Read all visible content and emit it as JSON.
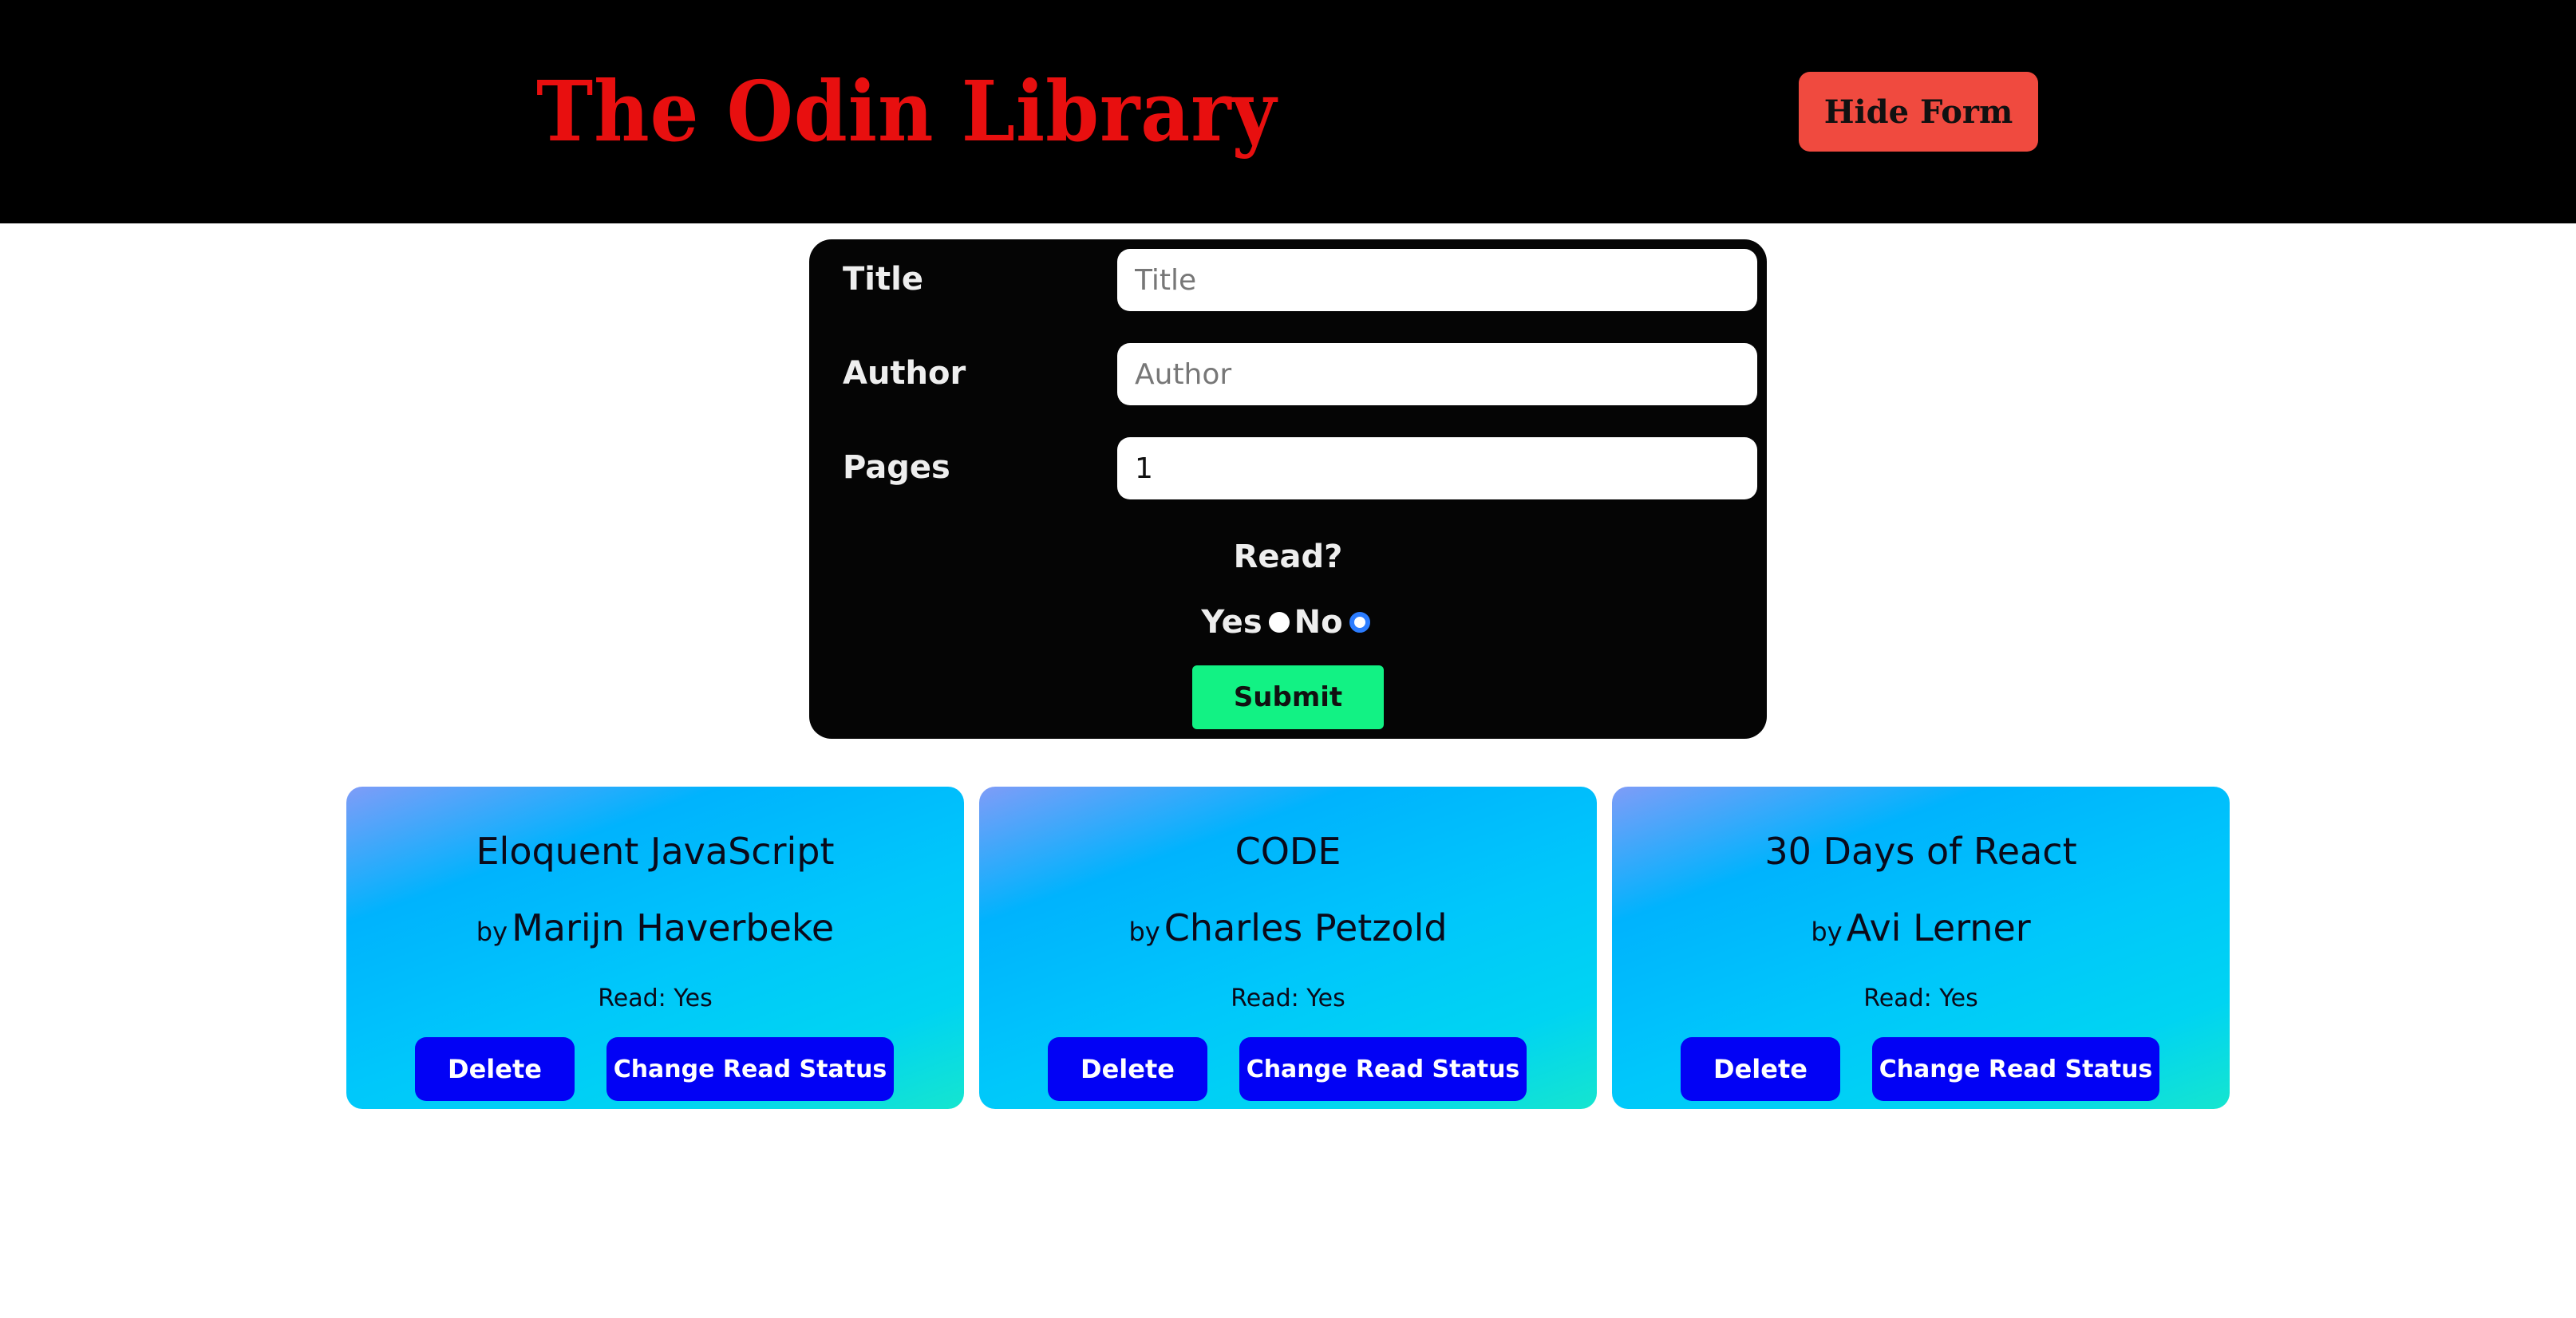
{
  "header": {
    "title": "The Odin Library",
    "hide_form_label": "Hide Form"
  },
  "form": {
    "title_label": "Title",
    "title_placeholder": "Title",
    "title_value": "",
    "author_label": "Author",
    "author_placeholder": "Author",
    "author_value": "",
    "pages_label": "Pages",
    "pages_value": "1",
    "read_question": "Read?",
    "yes_label": "Yes",
    "no_label": "No",
    "selected": "No",
    "submit_label": "Submit"
  },
  "books": [
    {
      "title": "Eloquent JavaScript",
      "by": "by",
      "author": "Marijn Haverbeke",
      "read_status": "Read: Yes",
      "delete_label": "Delete",
      "change_label": "Change Read Status"
    },
    {
      "title": "CODE",
      "by": "by",
      "author": "Charles Petzold",
      "read_status": "Read: Yes",
      "delete_label": "Delete",
      "change_label": "Change Read Status"
    },
    {
      "title": "30 Days of React",
      "by": "by",
      "author": "Avi Lerner",
      "read_status": "Read: Yes",
      "delete_label": "Delete",
      "change_label": "Change Read Status"
    }
  ],
  "colors": {
    "logo": "#e80f0f",
    "hide_button": "#f04a3f",
    "submit_button": "#12f284",
    "card_buttons": "#0202f5",
    "radio_selected": "#2b7cff"
  }
}
